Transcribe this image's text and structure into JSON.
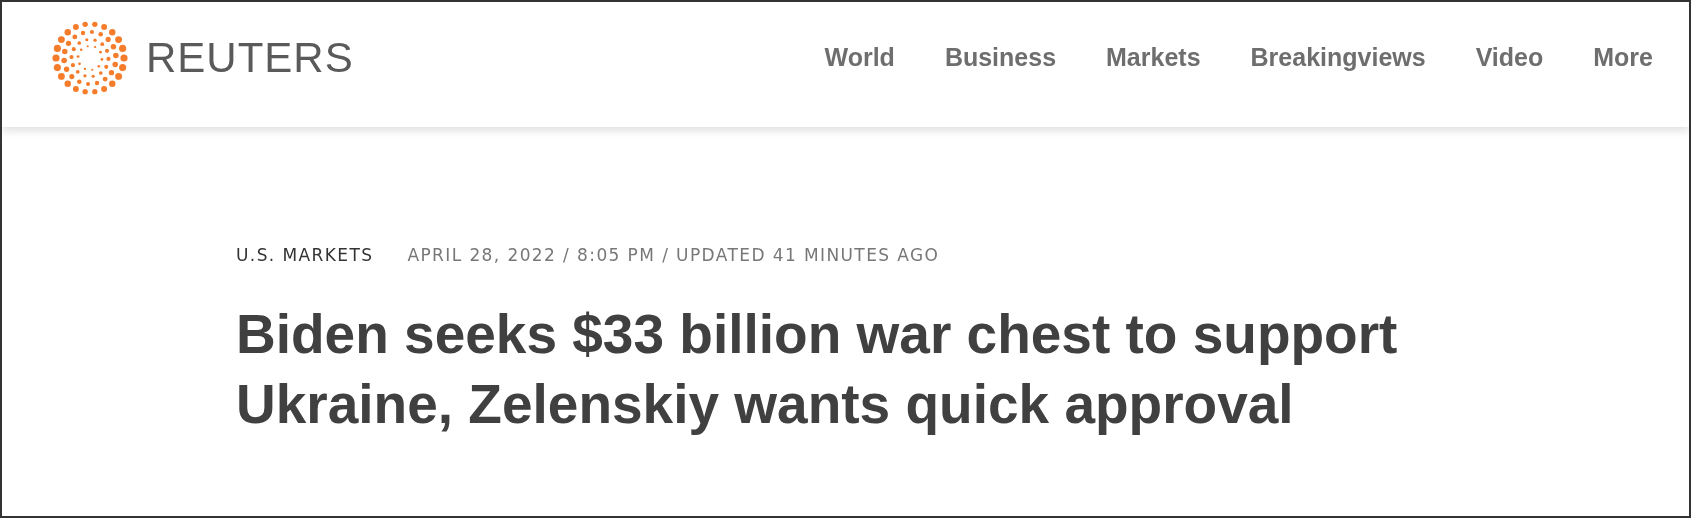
{
  "header": {
    "logo_text": "REUTERS",
    "nav": [
      {
        "label": "World"
      },
      {
        "label": "Business"
      },
      {
        "label": "Markets"
      },
      {
        "label": "Breakingviews"
      },
      {
        "label": "Video"
      },
      {
        "label": "More"
      }
    ]
  },
  "article": {
    "category": "U.S. MARKETS",
    "dateline": "APRIL 28, 2022 / 8:05 PM / UPDATED 41 MINUTES AGO",
    "headline": "Biden seeks $33 billion war chest to support Ukraine, Zelenskiy wants quick approval"
  }
}
